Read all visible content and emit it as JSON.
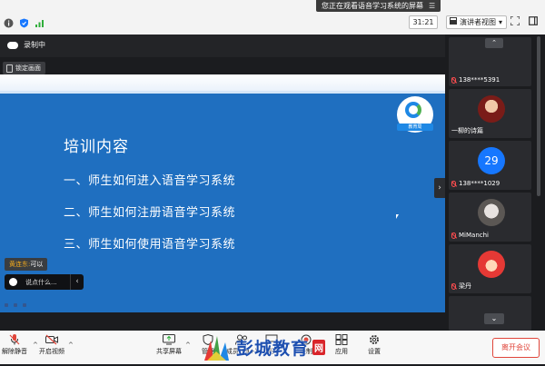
{
  "window": {
    "banner": "您正在观看语音学习系统的屏幕",
    "timer": "31:21",
    "view_mode": "演讲者视图"
  },
  "recording": {
    "status": "录制中",
    "lock_label": "锁定画面"
  },
  "slide": {
    "title": "培训内容",
    "items": [
      "一、师生如何进入语音学习系统",
      "二、师生如何注册语音学习系统",
      "三、师生如何使用语音学习系统"
    ],
    "logo_text": "教育局"
  },
  "chat": {
    "last_sender": "黄连东:",
    "last_message": "可以",
    "input_placeholder": "说点什么..."
  },
  "participants": [
    {
      "name": "138****5391",
      "avatar": "generic-avatar"
    },
    {
      "name": "一柳的诗篇",
      "avatar": "photo-avatar"
    },
    {
      "name": "138****1029",
      "avatar_number": "29"
    },
    {
      "name": "MiManchi",
      "avatar": "photo-avatar"
    },
    {
      "name": "梁丹",
      "avatar": "cartoon-avatar"
    }
  ],
  "toolbar": {
    "mute": "解除静音",
    "video": "开启视频",
    "share": "共享屏幕",
    "manage": "管理",
    "members": "成员(99+)",
    "chat": "聊天",
    "record": "录制",
    "apps": "应用",
    "settings": "设置",
    "leave": "离开会议"
  },
  "watermark": {
    "text": "彭城教育",
    "badge": "网"
  },
  "colors": {
    "slide_blue": "#1f6fc0",
    "accent": "#1677ff",
    "leave_red": "#e0463b"
  }
}
